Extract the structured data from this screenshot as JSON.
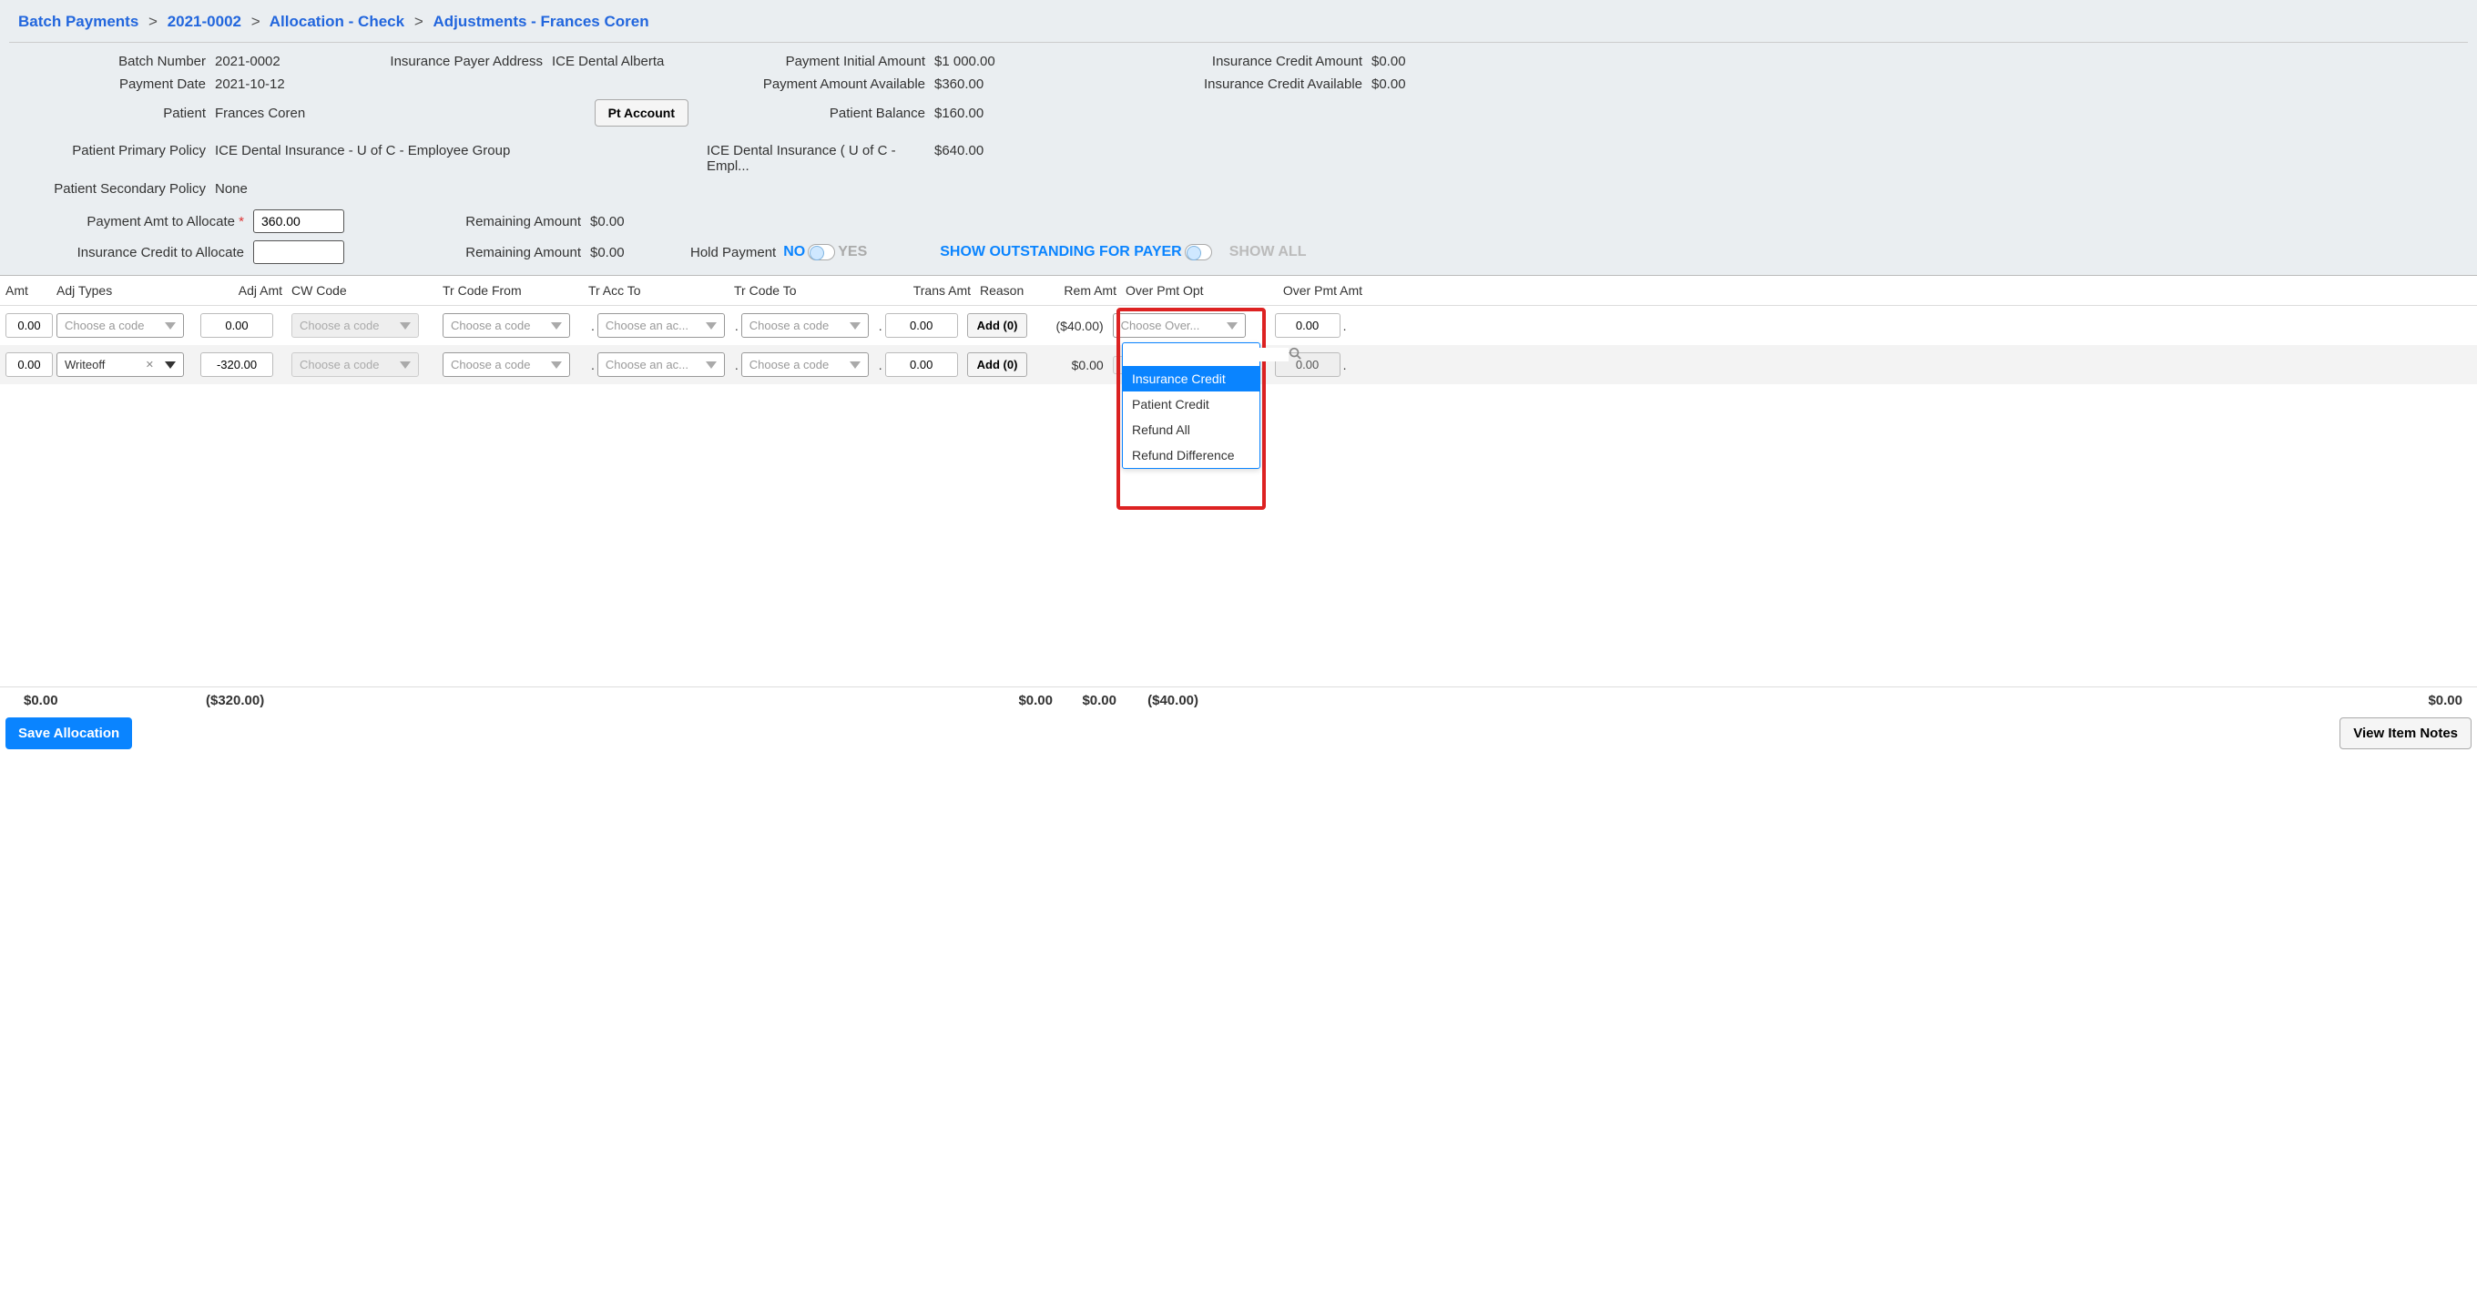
{
  "breadcrumb": {
    "items": [
      "Batch Payments",
      "2021-0002",
      "Allocation - Check"
    ],
    "current": "Adjustments - Frances Coren"
  },
  "info": {
    "batch_number_lbl": "Batch Number",
    "batch_number": "2021-0002",
    "ins_addr_lbl": "Insurance Payer Address",
    "ins_addr": "ICE Dental Alberta",
    "pay_init_lbl": "Payment Initial Amount",
    "pay_init": "$1 000.00",
    "ins_credit_amt_lbl": "Insurance Credit Amount",
    "ins_credit_amt": "$0.00",
    "pay_date_lbl": "Payment Date",
    "pay_date": "2021-10-12",
    "pay_avail_lbl": "Payment Amount Available",
    "pay_avail": "$360.00",
    "ins_credit_avail_lbl": "Insurance Credit Available",
    "ins_credit_avail": "$0.00",
    "patient_lbl": "Patient",
    "patient": "Frances Coren",
    "pt_account_btn": "Pt Account",
    "balance_lbl": "Patient Balance",
    "balance": "$160.00",
    "primary_lbl": "Patient Primary Policy",
    "primary": "ICE Dental Insurance - U of C - Employee Group",
    "primary_acc": "ICE Dental Insurance ( U of C - Empl...",
    "primary_amt": "$640.00",
    "secondary_lbl": "Patient Secondary Policy",
    "secondary": "None",
    "pay_alloc_lbl": "Payment Amt to Allocate",
    "pay_alloc": "360.00",
    "remaining_lbl": "Remaining Amount",
    "remaining1": "$0.00",
    "ins_alloc_lbl": "Insurance Credit to Allocate",
    "ins_alloc": "",
    "remaining2": "$0.00",
    "hold_lbl": "Hold Payment",
    "no": "NO",
    "yes": "YES",
    "show_payer": "SHOW OUTSTANDING FOR PAYER",
    "show_all": "SHOW ALL"
  },
  "headers": {
    "amt": "Amt",
    "adjtypes": "Adj Types",
    "adjamt": "Adj Amt",
    "cw": "CW Code",
    "trfrom": "Tr Code From",
    "tracc": "Tr Acc To",
    "trto": "Tr Code To",
    "transamt": "Trans Amt",
    "reason": "Reason",
    "remamt": "Rem Amt",
    "ovopt": "Over Pmt Opt",
    "ovamt": "Over Pmt Amt"
  },
  "placeholders": {
    "code": "Choose a code",
    "acc": "Choose an ac...",
    "over": "Choose Over..."
  },
  "rows": [
    {
      "amt": "0.00",
      "adjtype": "",
      "adjamt": "0.00",
      "trans": "0.00",
      "add": "Add (0)",
      "rem": "($40.00)",
      "ovamt": "0.00"
    },
    {
      "amt": "0.00",
      "adjtype": "Writeoff",
      "adjamt": "-320.00",
      "trans": "0.00",
      "add": "Add (0)",
      "rem": "$0.00",
      "ovamt": "0.00"
    }
  ],
  "dropdown": {
    "options": [
      "Insurance Credit",
      "Patient Credit",
      "Refund All",
      "Refund Difference"
    ]
  },
  "totals": {
    "amt": "$0.00",
    "adjamt": "($320.00)",
    "trans": "$0.00",
    "reason": "$0.00",
    "rem": "($40.00)",
    "ovamt": "$0.00"
  },
  "buttons": {
    "save": "Save Allocation",
    "notes": "View Item Notes"
  }
}
